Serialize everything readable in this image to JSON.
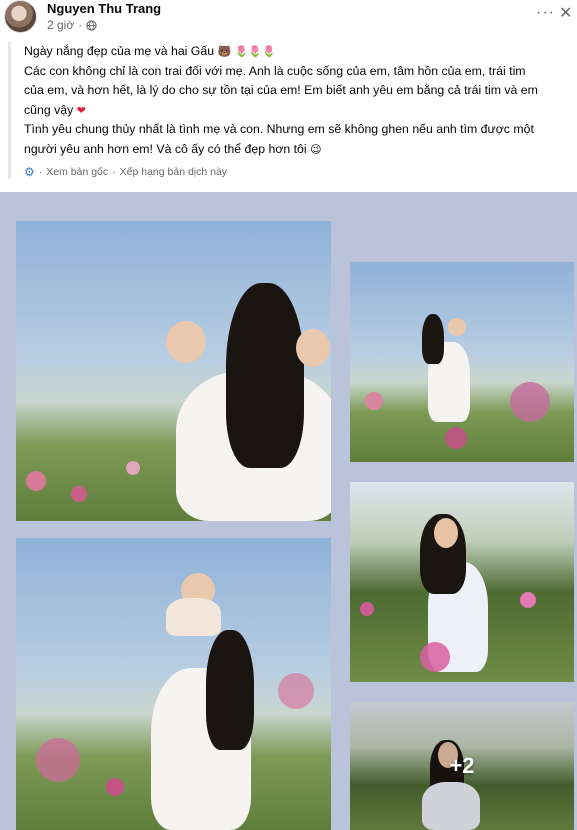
{
  "post": {
    "author": "Nguyen Thu Trang",
    "time": "2 giờ",
    "lines": [
      "Ngày nắng đẹp của mẹ và hai Gấu",
      "Các con không chỉ là con trai đối với mẹ. Anh là cuộc sống của em, tâm hồn của em, trái tim",
      "của em, và hơn hết, là lý do cho sự tồn tại của em! Em biết anh yêu em bằng cả trái tim và em",
      "cũng vậy",
      "Tình yêu chung thủy nhất là tình mẹ và con. Nhưng em sẽ không ghen nếu anh tìm được một",
      "người yêu anh hơn em! Và cô ấy có thể đẹp hơn tôi"
    ],
    "line1_emoji": "🐻 🌷🌷🌷",
    "line4_emoji": "❤",
    "line6_emoji": "😉",
    "see_original": "Xem bản gốc",
    "separator": "·",
    "rate_translation": "Xếp hạng bản dịch này"
  },
  "gallery": {
    "more_count": "+2",
    "background": "#bac3d9"
  },
  "icons": {
    "globe": "globe-icon",
    "more": "more-options-icon",
    "close": "close-icon",
    "gear": "gear-icon"
  }
}
